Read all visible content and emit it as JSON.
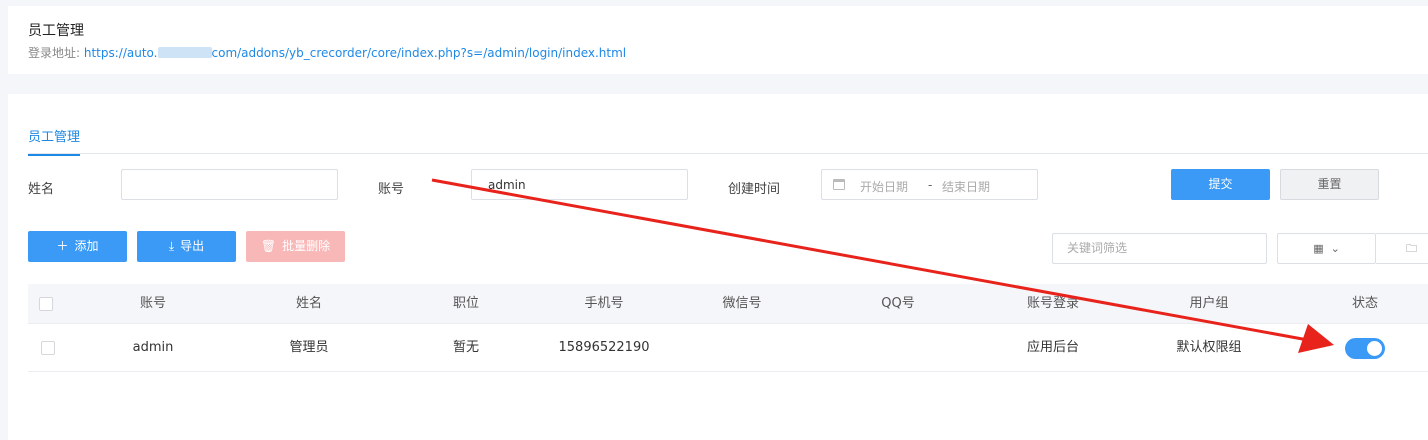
{
  "header": {
    "title": "员工管理",
    "address_label": "登录地址:",
    "address_prefix": "https://auto.",
    "address_suffix": "com/addons/yb_crecorder/core/index.php?s=/admin/login/index.html"
  },
  "tabs": [
    {
      "label": "员工管理",
      "active": true
    }
  ],
  "filters": {
    "name_label": "姓名",
    "name_value": "",
    "account_label": "账号",
    "account_value": "admin",
    "created_label": "创建时间",
    "date_start_placeholder": "开始日期",
    "date_separator": "-",
    "date_end_placeholder": "结束日期",
    "submit_label": "提交",
    "reset_label": "重置"
  },
  "toolbar": {
    "add_label": "添加",
    "export_label": "导出",
    "batch_delete_label": "批量删除",
    "keyword_placeholder": "关键词筛选"
  },
  "table": {
    "columns": [
      "账号",
      "姓名",
      "职位",
      "手机号",
      "微信号",
      "QQ号",
      "账号登录",
      "用户组",
      "状态"
    ],
    "rows": [
      {
        "account": "admin",
        "name": "管理员",
        "position": "暂无",
        "phone": "15896522190",
        "wechat": "",
        "qq": "",
        "login": "应用后台",
        "group": "默认权限组",
        "status_on": true
      }
    ]
  },
  "colors": {
    "primary": "#3a9af5",
    "link": "#1e88e5",
    "danger_disabled": "#f8b8b8",
    "annotation_arrow": "#e8231b"
  }
}
